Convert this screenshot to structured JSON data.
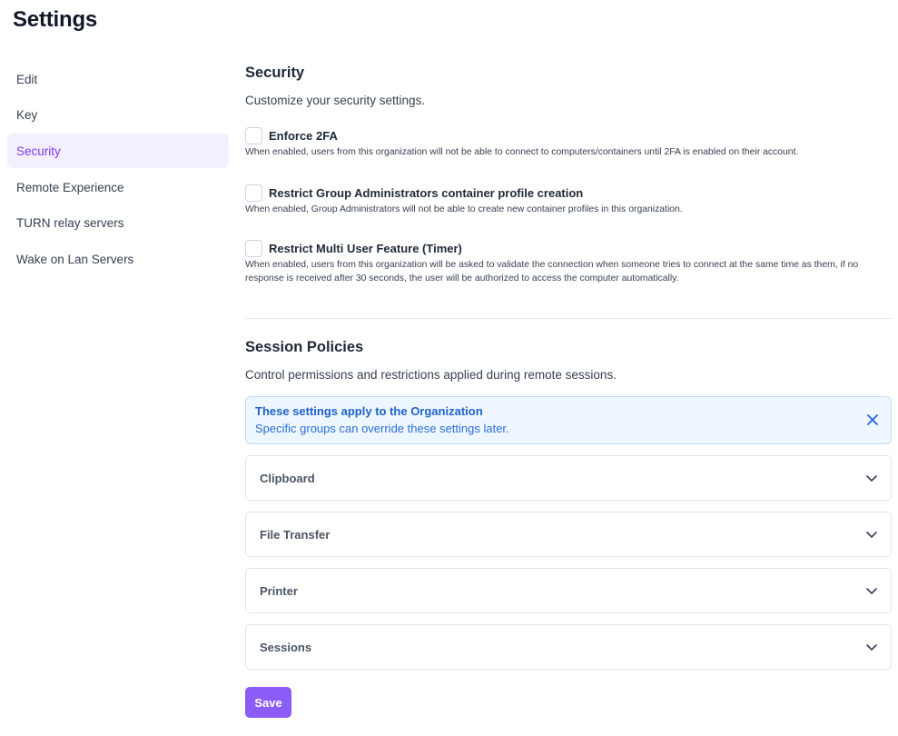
{
  "page": {
    "title": "Settings"
  },
  "sidebar": {
    "items": [
      {
        "label": "Edit"
      },
      {
        "label": "Key"
      },
      {
        "label": "Security",
        "active": true
      },
      {
        "label": "Remote Experience"
      },
      {
        "label": "TURN relay servers"
      },
      {
        "label": "Wake on Lan Servers"
      }
    ]
  },
  "security": {
    "title": "Security",
    "description": "Customize your security settings.",
    "options": [
      {
        "label": "Enforce 2FA",
        "checked": false,
        "help": "When enabled, users from this organization will not be able to connect to computers/containers until 2FA is enabled on their account."
      },
      {
        "label": "Restrict Group Administrators container profile creation",
        "checked": false,
        "help": "When enabled, Group Administrators will not be able to create new container profiles in this organization."
      },
      {
        "label": "Restrict Multi User Feature (Timer)",
        "checked": false,
        "help": "When enabled, users from this organization will be asked to validate the connection when someone tries to connect at the same time as them, if no response is received after 30 seconds, the user will be authorized to access the computer automatically."
      }
    ]
  },
  "session_policies": {
    "title": "Session Policies",
    "description": "Control permissions and restrictions applied during remote sessions.",
    "alert": {
      "title": "These settings apply to the Organization",
      "body": "Specific groups can override these settings later.",
      "close_icon": "close-icon"
    },
    "accordions": [
      {
        "label": "Clipboard",
        "icon": "chevron-down-icon"
      },
      {
        "label": "File Transfer",
        "icon": "chevron-down-icon"
      },
      {
        "label": "Printer",
        "icon": "chevron-down-icon"
      },
      {
        "label": "Sessions",
        "icon": "chevron-down-icon"
      }
    ]
  },
  "actions": {
    "save_label": "Save"
  },
  "colors": {
    "accent": "#8b5cf6",
    "active_nav_bg": "#f3effe",
    "active_nav_text": "#7c3aed",
    "info_bg": "#eef6ff",
    "info_text": "#1d63c7"
  }
}
